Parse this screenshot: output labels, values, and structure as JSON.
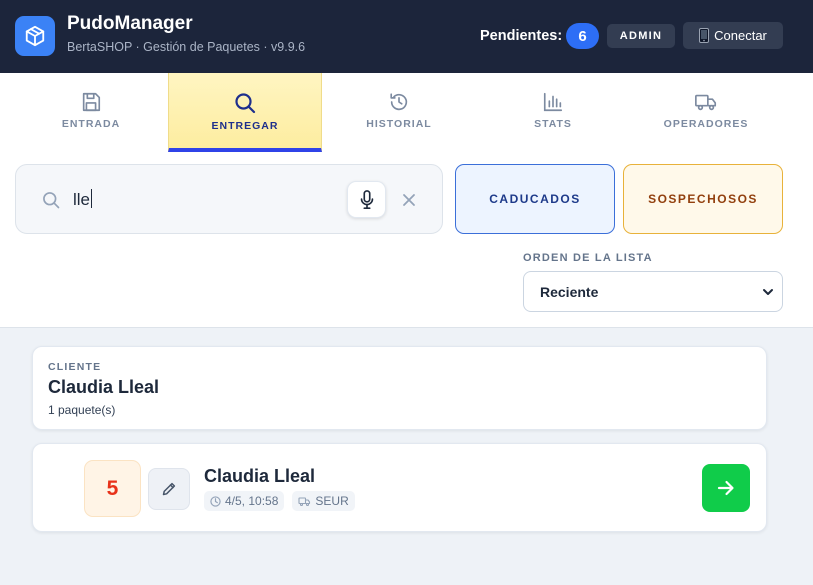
{
  "header": {
    "app_name": "PudoManager",
    "subtitle": "BertaSHOP · Gestión de Paquetes · v9.9.6",
    "pending_label": "Pendientes:",
    "pending_count": "6",
    "admin_label": "ADMIN",
    "connect_label": "Conectar",
    "logo_icon": "package-icon",
    "connect_icon": "phone-icon",
    "colors": {
      "background": "#1c253b",
      "accent": "#3b82f6"
    }
  },
  "tabs": [
    {
      "label": "ENTRADA",
      "icon": "save-icon",
      "active": false
    },
    {
      "label": "ENTREGAR",
      "icon": "search-icon",
      "active": true
    },
    {
      "label": "HISTORIAL",
      "icon": "history-icon",
      "active": false
    },
    {
      "label": "STATS",
      "icon": "bar-chart-icon",
      "active": false
    },
    {
      "label": "OPERADORES",
      "icon": "truck-icon",
      "active": false
    }
  ],
  "search": {
    "value": "lle",
    "icons": [
      "search-icon",
      "microphone-icon",
      "close-icon"
    ]
  },
  "filters": {
    "caducados": "CADUCADOS",
    "sospechosos": "SOSPECHOSOS"
  },
  "order": {
    "label": "ORDEN DE LA LISTA",
    "selected": "Reciente"
  },
  "client": {
    "label": "CLIENTE",
    "name": "Claudia Lleal",
    "count": "1 paquete(s)"
  },
  "package": {
    "number": "5",
    "name": "Claudia Lleal",
    "date": "4/5, 10:58",
    "carrier": "SEUR",
    "colors": {
      "number": "#e8321a",
      "go_button": "#10cc4a"
    }
  }
}
